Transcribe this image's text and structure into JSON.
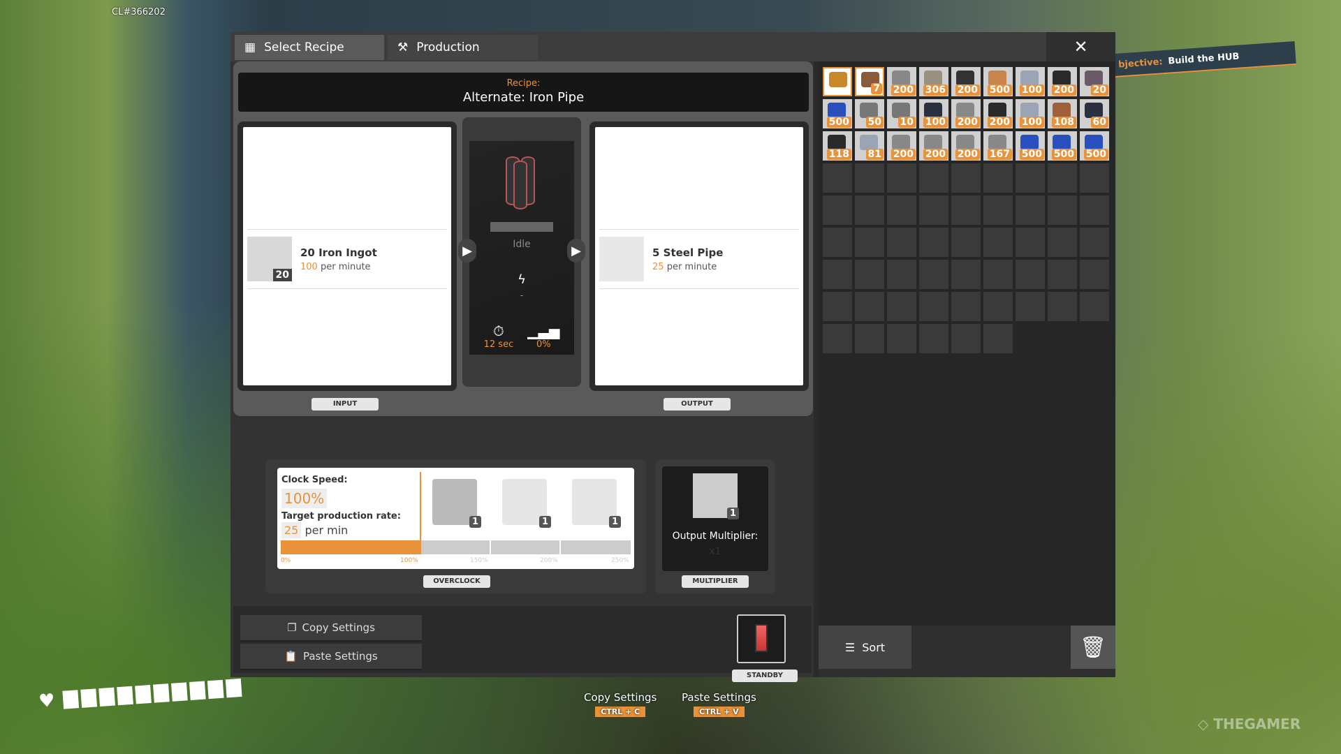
{
  "hud": {
    "build_id": "CL#366202",
    "objective_label": "bjective:",
    "objective_value": "Build the HUB",
    "watermark": "THEGAMER",
    "health_cells": 10,
    "hints": [
      {
        "label": "Copy Settings",
        "key": "CTRL + C"
      },
      {
        "label": "Paste Settings",
        "key": "CTRL + V"
      }
    ]
  },
  "tabs": [
    {
      "label": "Select Recipe",
      "icon": "grid-icon"
    },
    {
      "label": "Production",
      "icon": "hammer-icon"
    }
  ],
  "recipe": {
    "label": "Recipe:",
    "name": "Alternate: Iron Pipe"
  },
  "input": {
    "tag": "INPUT",
    "item": "20 Iron Ingot",
    "count": "20",
    "rate": "100",
    "rate_unit": "per minute"
  },
  "output": {
    "tag": "OUTPUT",
    "item": "5 Steel Pipe",
    "rate": "25",
    "rate_unit": "per minute"
  },
  "machine": {
    "status": "Idle",
    "power": "-",
    "cycle_time": "12 sec",
    "productivity": "0%"
  },
  "overclock": {
    "tag": "OVERCLOCK",
    "clock_label": "Clock Speed:",
    "clock_value": "100%",
    "target_label": "Target production rate:",
    "target_value": "25",
    "target_unit": "per min",
    "fill_percent": 100,
    "ticks": [
      "0%",
      "100%",
      "150%",
      "200%",
      "250%"
    ],
    "shard_counts": [
      "1",
      "1",
      "1"
    ]
  },
  "multiplier": {
    "tag": "MULTIPLIER",
    "label": "Output Multiplier:",
    "value": "x1",
    "count": "1"
  },
  "actions": {
    "copy": "Copy Settings",
    "paste": "Paste Settings",
    "standby": "STANDBY"
  },
  "inventory": {
    "sort": "Sort",
    "total_slots": 78,
    "items": [
      {
        "icon": "xeno-zapper",
        "count": "",
        "selected": true
      },
      {
        "icon": "equipment",
        "count": "7",
        "selected": true
      },
      {
        "icon": "iron-plate",
        "count": "200"
      },
      {
        "icon": "concrete",
        "count": "306"
      },
      {
        "icon": "iron-rod",
        "count": "200"
      },
      {
        "icon": "copper-wire",
        "count": "500"
      },
      {
        "icon": "steel-beam",
        "count": "100"
      },
      {
        "icon": "steel-pipe",
        "count": "200"
      },
      {
        "icon": "ore",
        "count": "20"
      },
      {
        "icon": "iron-ore",
        "count": "500"
      },
      {
        "icon": "frame",
        "count": "50"
      },
      {
        "icon": "frame",
        "count": "10"
      },
      {
        "icon": "barrel",
        "count": "100"
      },
      {
        "icon": "iron-plate",
        "count": "200"
      },
      {
        "icon": "steel-pipe",
        "count": "200"
      },
      {
        "icon": "steel-beam",
        "count": "100"
      },
      {
        "icon": "copper-rod",
        "count": "108"
      },
      {
        "icon": "barrel",
        "count": "60"
      },
      {
        "icon": "steel-pipe",
        "count": "118"
      },
      {
        "icon": "steel-beam",
        "count": "81"
      },
      {
        "icon": "iron-plate",
        "count": "200"
      },
      {
        "icon": "iron-plate",
        "count": "200"
      },
      {
        "icon": "iron-plate",
        "count": "200"
      },
      {
        "icon": "iron-plate",
        "count": "167"
      },
      {
        "icon": "iron-ore",
        "count": "500"
      },
      {
        "icon": "iron-ore",
        "count": "500"
      },
      {
        "icon": "iron-ore",
        "count": "500"
      }
    ]
  },
  "colors": {
    "accent": "#e8923a",
    "panel": "#2a2a2a"
  }
}
